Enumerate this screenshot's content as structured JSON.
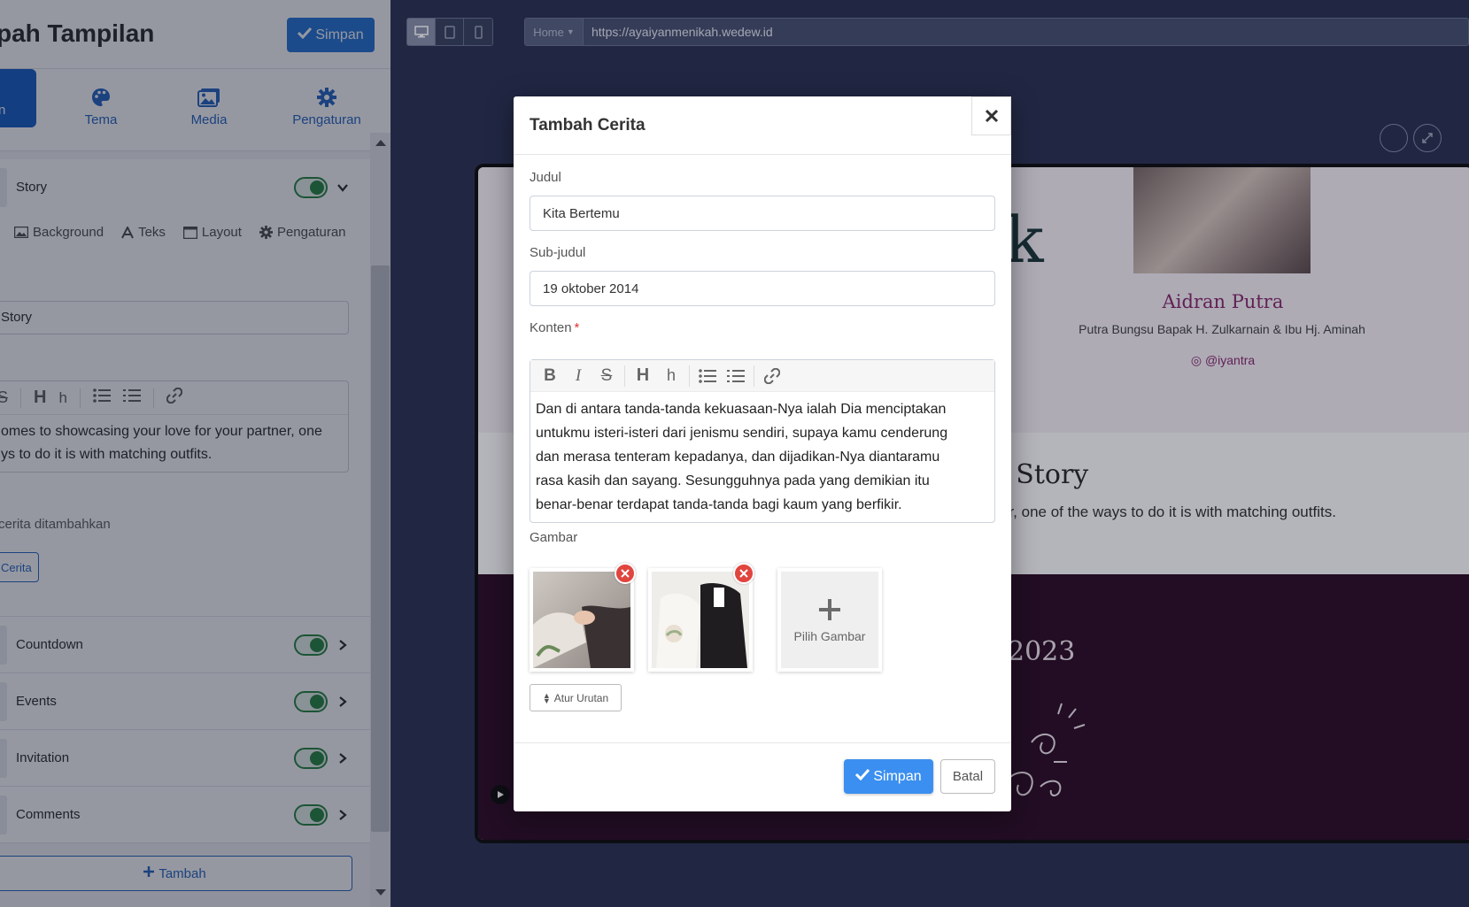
{
  "editor": {
    "page_heading": "pah Tampilan",
    "save_label": "Simpan",
    "tabs": [
      {
        "label": "n",
        "icon": "layout-icon"
      },
      {
        "label": "Tema",
        "icon": "palette-icon"
      },
      {
        "label": "Media",
        "icon": "images-icon"
      },
      {
        "label": "Pengaturan",
        "icon": "gear-icon"
      }
    ],
    "story_section": {
      "name": "Story",
      "enabled": true,
      "subtabs": [
        "Background",
        "Teks",
        "Layout",
        "Pengaturan"
      ],
      "title_value": "Story",
      "content_line1": "omes to showcasing your love for your partner, one",
      "content_line2": "ys to do it is with matching outfits.",
      "count_text": "cerita ditambahkan",
      "add_label": "Cerita"
    },
    "sections": [
      {
        "name": "Countdown",
        "enabled": true
      },
      {
        "name": "Events",
        "enabled": true
      },
      {
        "name": "Invitation",
        "enabled": true
      },
      {
        "name": "Comments",
        "enabled": true
      }
    ],
    "add_section_label": "Tambah"
  },
  "preview": {
    "url_home": "Home",
    "url": "https://ayaiyanmenikah.wedew.id",
    "devices": [
      "desktop-icon",
      "tablet-icon",
      "mobile-icon"
    ],
    "groom_name": "Aidran Putra",
    "groom_parents": "Putra Bungsu Bapak H. Zulkarnain & Ibu Hj. Aminah",
    "groom_instagram": "@iyantra",
    "big_letter": "k",
    "story_heading": "e Story",
    "story_desc": "er, one of the ways to do it is with matching outfits.",
    "year": "2023"
  },
  "modal": {
    "title": "Tambah Cerita",
    "judul_label": "Judul",
    "judul_value": "Kita Bertemu",
    "subjudul_label": "Sub-judul",
    "subjudul_value": "19 oktober 2014",
    "konten_label": "Konten",
    "required_mark": "*",
    "konten_lines": [
      "Dan di antara tanda-tanda kekuasaan-Nya ialah Dia menciptakan",
      "untukmu isteri-isteri dari jenismu sendiri, supaya kamu cenderung",
      "dan merasa tenteram kepadanya, dan dijadikan-Nya diantaramu",
      "rasa kasih dan sayang. Sesungguhnya pada yang demikian itu",
      "benar-benar terdapat tanda-tanda bagi kaum yang berfikir."
    ],
    "gambar_label": "Gambar",
    "pick_image_label": "Pilih Gambar",
    "sort_label": "Atur Urutan",
    "save_label": "Simpan",
    "cancel_label": "Batal"
  },
  "colors": {
    "primary": "#2b7bd9",
    "toggle_on": "#2e8a47",
    "danger": "#e0453e",
    "preview_accent": "#8a2c6e"
  }
}
